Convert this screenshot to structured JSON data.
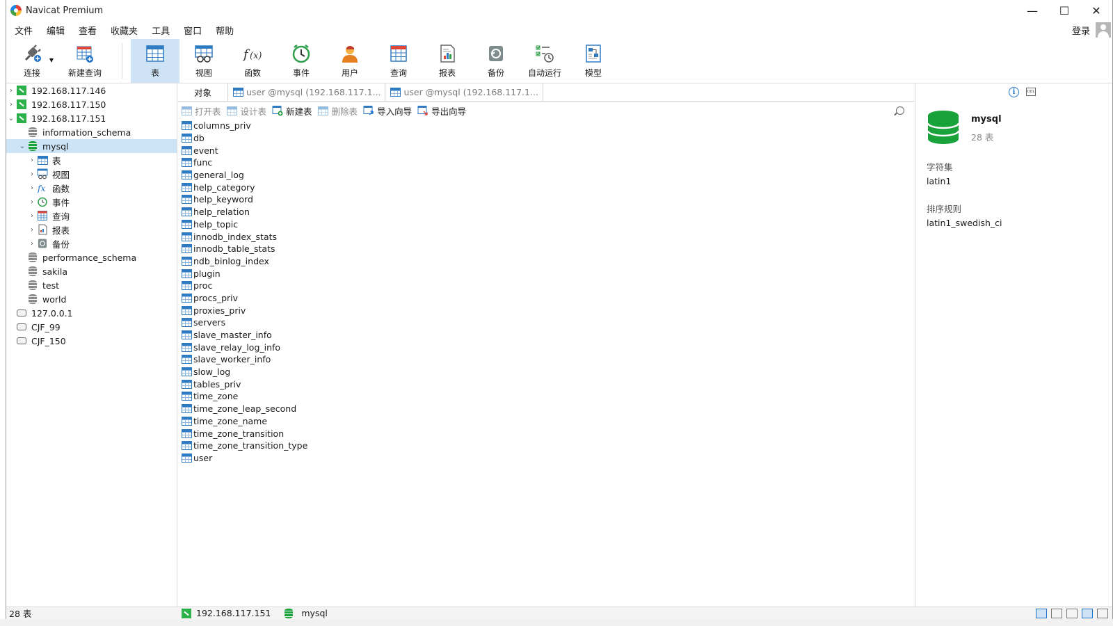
{
  "window": {
    "title": "Navicat Premium",
    "minimize": "—",
    "maximize": "☐",
    "close": "✕"
  },
  "menu": [
    "文件",
    "编辑",
    "查看",
    "收藏夹",
    "工具",
    "窗口",
    "帮助"
  ],
  "login": "登录",
  "toolbar": {
    "connect": "连接",
    "new_query": "新建查询",
    "table": "表",
    "view": "视图",
    "function": "函数",
    "event": "事件",
    "user": "用户",
    "query": "查询",
    "report": "报表",
    "backup": "备份",
    "auto_run": "自动运行",
    "model": "模型"
  },
  "tree": {
    "connections": [
      "192.168.117.146",
      "192.168.117.150",
      "192.168.117.151"
    ],
    "dbs_before": [
      "information_schema"
    ],
    "selected_db": "mysql",
    "children": [
      "表",
      "视图",
      "函数",
      "事件",
      "查询",
      "报表",
      "备份"
    ],
    "dbs_after": [
      "performance_schema",
      "sakila",
      "test",
      "world"
    ],
    "other_connections": [
      "127.0.0.1",
      "CJF_99",
      "CJF_150"
    ]
  },
  "tabs": {
    "object": "对象",
    "tab1": "user @mysql (192.168.117.1...",
    "tab2": "user @mysql (192.168.117.1..."
  },
  "objbar": {
    "open": "打开表",
    "design": "设计表",
    "new": "新建表",
    "delete": "删除表",
    "import": "导入向导",
    "export": "导出向导"
  },
  "tables": [
    "columns_priv",
    "db",
    "event",
    "func",
    "general_log",
    "help_category",
    "help_keyword",
    "help_relation",
    "help_topic",
    "innodb_index_stats",
    "innodb_table_stats",
    "ndb_binlog_index",
    "plugin",
    "proc",
    "procs_priv",
    "proxies_priv",
    "servers",
    "slave_master_info",
    "slave_relay_log_info",
    "slave_worker_info",
    "slow_log",
    "tables_priv",
    "time_zone",
    "time_zone_leap_second",
    "time_zone_name",
    "time_zone_transition",
    "time_zone_transition_type",
    "user"
  ],
  "info": {
    "name": "mysql",
    "count": "28 表",
    "charset_label": "字符集",
    "charset": "latin1",
    "collation_label": "排序规则",
    "collation": "latin1_swedish_ci"
  },
  "status": {
    "count": "28 表",
    "connection": "192.168.117.151",
    "database": "mysql"
  },
  "colors": {
    "accent": "#1e73c8",
    "selected": "#cde4f7",
    "connection": "#2bb04a",
    "db_active": "#19a23a"
  }
}
